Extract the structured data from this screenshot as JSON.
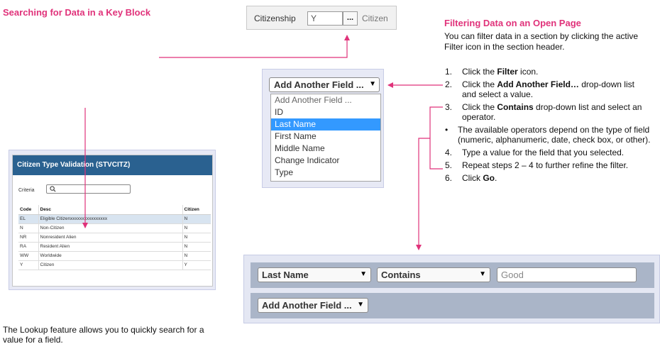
{
  "left_heading": "Searching for Data in a Key Block",
  "right_heading": "Filtering Data on an Open Page",
  "intro": "You can filter data in a section by clicking the active Filter icon in the section header.",
  "key_block": {
    "label": "Citizenship",
    "value": "Y",
    "lookup_button": "...",
    "description": "Citizen"
  },
  "validation": {
    "title": "Citizen Type Validation (STVCITZ)",
    "criteria_label": "Criteria",
    "search_icon": "search-icon",
    "columns": [
      "Code",
      "Desc",
      "Citizen"
    ],
    "rows": [
      [
        "EL",
        "Eligible Citizenxxxxxxxxxxxxxxxx",
        "N"
      ],
      [
        "N",
        "Non-Citizen",
        "N"
      ],
      [
        "NR",
        "Nonresident Alien",
        "N"
      ],
      [
        "RA",
        "Resident Alien",
        "N"
      ],
      [
        "WW",
        "Worldwide",
        "N"
      ],
      [
        "Y",
        "Citizen",
        "Y"
      ]
    ]
  },
  "dropdown": {
    "selected": "Add Another Field ...",
    "options": [
      "Add Another Field ...",
      "ID",
      "Last Name",
      "First Name",
      "Middle Name",
      "Change Indicator",
      "Type"
    ],
    "highlighted_index": 2
  },
  "steps": {
    "s1": {
      "num": "1.",
      "pre": "Click the ",
      "bold": "Filter",
      "post": " icon."
    },
    "s2": {
      "num": "2.",
      "pre": "Click the ",
      "bold": "Add Another Field…",
      "post": " drop-down list and select a value."
    },
    "s3": {
      "num": "3.",
      "pre": "Click the ",
      "bold": "Contains",
      "post": " drop-down list and select an operator."
    },
    "note": {
      "bullet": "•",
      "text": "The available operators depend on the type of field (numeric, alphanumeric, date, check box, or other)."
    },
    "s4": {
      "num": "4.",
      "text": "Type a value for the field that you selected."
    },
    "s5": {
      "num": "5.",
      "text": "Repeat steps 2 – 4 to further refine the filter."
    },
    "s6": {
      "num": "6.",
      "pre": "Click ",
      "bold": "Go",
      "post": "."
    }
  },
  "filter_bar": {
    "field": "Last Name",
    "operator": "Contains",
    "value": "Good",
    "add_field": "Add Another Field ..."
  },
  "footer": "The Lookup feature allows you to quickly search for a value for a field.",
  "colors": {
    "accent": "#e0327a",
    "header_blue": "#2a6190",
    "highlight": "#3399ff"
  }
}
